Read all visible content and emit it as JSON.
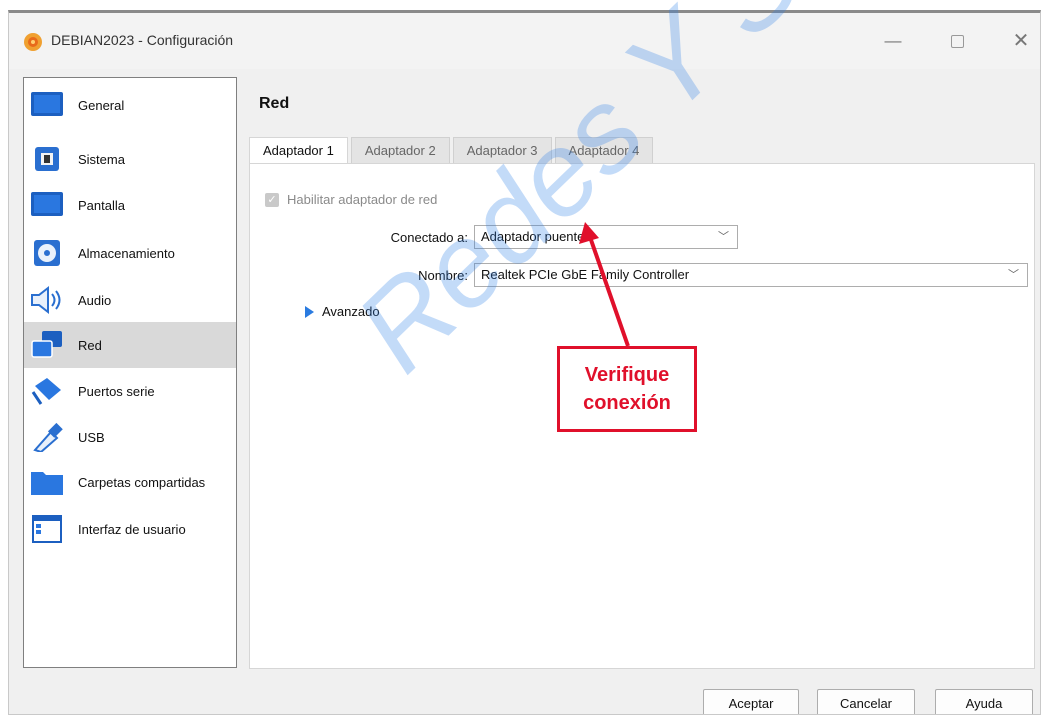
{
  "window": {
    "title": "DEBIAN2023 - Configuración"
  },
  "sidebar": {
    "items": [
      {
        "label": "General",
        "icon": "monitor-icon"
      },
      {
        "label": "Sistema",
        "icon": "chip-icon"
      },
      {
        "label": "Pantalla",
        "icon": "display-icon"
      },
      {
        "label": "Almacenamiento",
        "icon": "disk-icon"
      },
      {
        "label": "Audio",
        "icon": "speaker-icon"
      },
      {
        "label": "Red",
        "icon": "network-icon",
        "selected": true
      },
      {
        "label": "Puertos serie",
        "icon": "serial-port-icon"
      },
      {
        "label": "USB",
        "icon": "usb-icon"
      },
      {
        "label": "Carpetas compartidas",
        "icon": "folder-icon"
      },
      {
        "label": "Interfaz de usuario",
        "icon": "window-icon"
      }
    ]
  },
  "main": {
    "title": "Red",
    "tabs": [
      "Adaptador 1",
      "Adaptador 2",
      "Adaptador 3",
      "Adaptador 4"
    ],
    "enable_adapter_label": "Habilitar adaptador de red",
    "connected_label": "Conectado a:",
    "connected_value": "Adaptador puente",
    "name_label": "Nombre:",
    "name_value": "Realtek PCIe GbE Family Controller",
    "advanced_label": "Avanzado"
  },
  "annotation": {
    "line1": "Verifique",
    "line2": "conexión"
  },
  "buttons": {
    "accept": "Aceptar",
    "cancel": "Cancelar",
    "help": "Ayuda"
  },
  "watermark": "Redes Y Seguridad",
  "colors": {
    "accent": "#2a7be0",
    "annotation": "#e0102b",
    "watermark": "#2d7fe8"
  }
}
